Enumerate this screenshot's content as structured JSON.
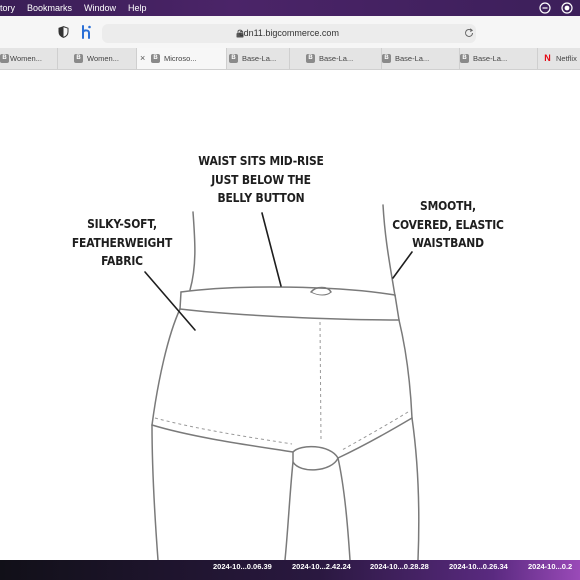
{
  "menubar": {
    "items": [
      "tory",
      "Bookmarks",
      "Window",
      "Help"
    ]
  },
  "toolbar": {
    "url": "cdn11.bigcommerce.com"
  },
  "tabs": [
    {
      "label": "Women...",
      "favicon": "B"
    },
    {
      "label": "Women...",
      "favicon": "B"
    },
    {
      "label": "Microso...",
      "favicon": "B",
      "active": true,
      "close": "×"
    },
    {
      "label": "Base-La...",
      "favicon": "B"
    },
    {
      "label": "Base-La...",
      "favicon": "B"
    },
    {
      "label": "Base-La...",
      "favicon": "B"
    },
    {
      "label": "Base-La...",
      "favicon": "B"
    },
    {
      "label": "Netflix",
      "favicon": "N"
    }
  ],
  "diagram": {
    "waist_label": [
      "WAIST SITS MID-RISE",
      "JUST BELOW THE",
      "BELLY BUTTON"
    ],
    "fabric_label": [
      "SILKY-SOFT,",
      "FEATHERWEIGHT",
      "FABRIC"
    ],
    "waistband_label": [
      "SMOOTH,",
      "COVERED, ELASTIC",
      "WAISTBAND"
    ]
  },
  "dock": {
    "screenshots": [
      "2024-10...0.06.39",
      "2024-10...2.42.24",
      "2024-10...0.28.28",
      "2024-10...0.26.34",
      "2024-10...0.2"
    ]
  },
  "colors": {
    "menubar": "#3a1e56",
    "ink": "#1e1e1e",
    "outline": "#777777"
  }
}
